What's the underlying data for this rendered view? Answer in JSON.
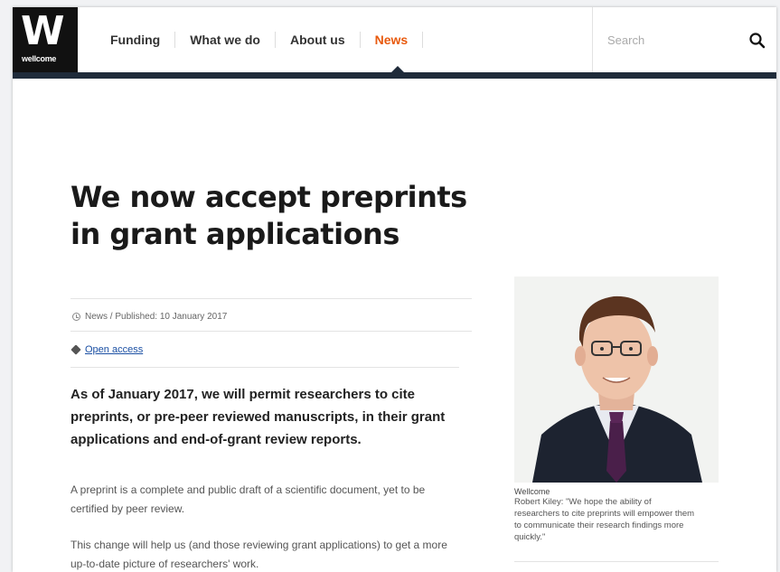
{
  "logo": {
    "letter": "W",
    "wordmark": "wellcome"
  },
  "nav": {
    "items": [
      {
        "label": "Funding"
      },
      {
        "label": "What we do"
      },
      {
        "label": "About us"
      },
      {
        "label": "News",
        "active": true
      }
    ]
  },
  "search": {
    "placeholder": "Search"
  },
  "article": {
    "title": "We now accept preprints in grant applications",
    "meta": "News / Published: 10 January 2017",
    "tag": "Open access",
    "lead": "As of January 2017, we will permit researchers to cite preprints, or pre-peer reviewed manuscripts, in their grant applications and end-of-grant review reports.",
    "paragraphs": [
      "A preprint is a complete and public draft of a scientific document, yet to be certified by peer review.",
      "This change will help us (and those reviewing grant applications) to get a more up-to-date picture of researchers' work."
    ]
  },
  "sidebar": {
    "credit": "Wellcome",
    "caption": "Robert Kiley: \"We hope the ability of researchers to cite preprints will empower them to communicate their research findings more quickly.\""
  },
  "colors": {
    "accent": "#e85a0e",
    "header_bar": "#1f2b3a",
    "link": "#1a4fa3"
  }
}
